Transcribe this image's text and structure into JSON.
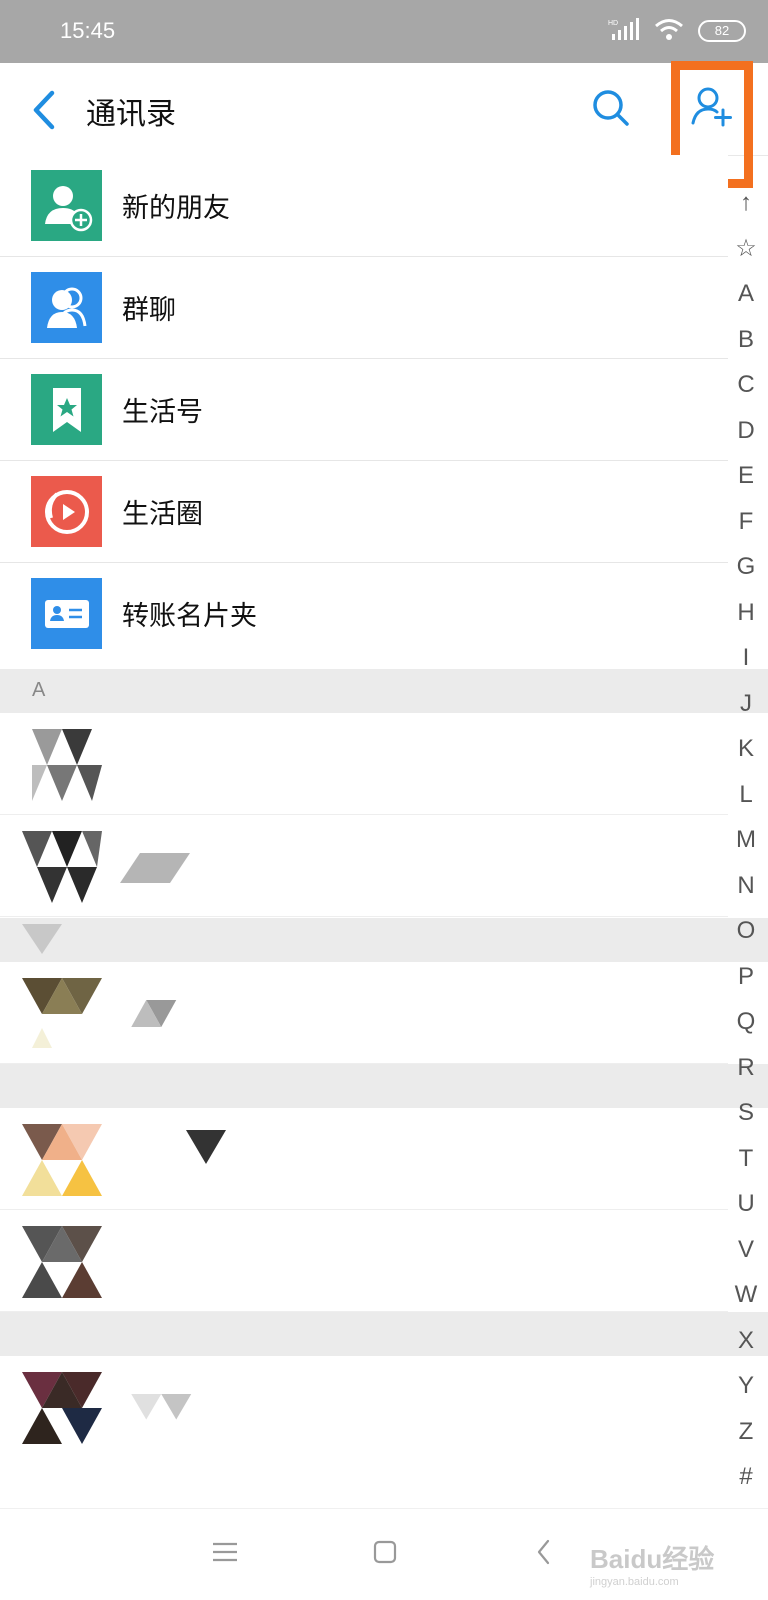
{
  "status_bar": {
    "time": "15:45",
    "network": "HD",
    "battery": "82"
  },
  "header": {
    "title": "通讯录"
  },
  "entries": [
    {
      "label": "新的朋友",
      "color": "#2aa883",
      "icon": "add-friend-icon"
    },
    {
      "label": "群聊",
      "color": "#2f8ee8",
      "icon": "group-chat-icon"
    },
    {
      "label": "生活号",
      "color": "#2aa883",
      "icon": "bookmark-star-icon"
    },
    {
      "label": "生活圈",
      "color": "#eb5a4c",
      "icon": "life-circle-icon"
    },
    {
      "label": "转账名片夹",
      "color": "#2f8ee8",
      "icon": "card-holder-icon"
    }
  ],
  "sections": [
    {
      "letter": "A"
    }
  ],
  "alphabet": [
    "↑",
    "☆",
    "A",
    "B",
    "C",
    "D",
    "E",
    "F",
    "G",
    "H",
    "I",
    "J",
    "K",
    "L",
    "M",
    "N",
    "O",
    "P",
    "Q",
    "R",
    "S",
    "T",
    "U",
    "V",
    "W",
    "X",
    "Y",
    "Z",
    "#"
  ],
  "watermark": {
    "main": "Baidu经验",
    "sub": "jingyan.baidu.com"
  },
  "colors": {
    "accent": "#1f8de0",
    "highlight": "#f3701f"
  }
}
